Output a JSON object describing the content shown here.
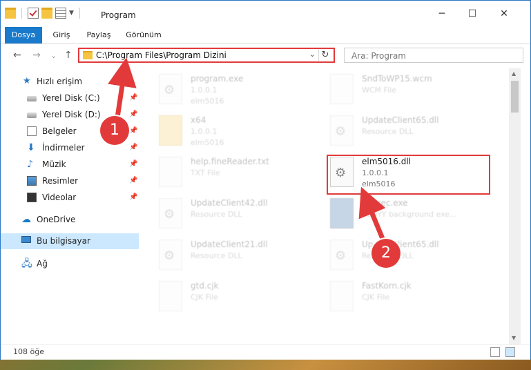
{
  "window": {
    "title": "Program",
    "controls": {
      "minimize": "─",
      "maximize": "☐",
      "close": "✕"
    }
  },
  "ribbon": {
    "tabs": [
      "Dosya",
      "Giriş",
      "Paylaş",
      "Görünüm"
    ],
    "help": "?"
  },
  "navigation": {
    "back": "←",
    "forward": "→",
    "recent": "⌄",
    "up": "↑",
    "address": "C:\\Program Files\\Program Dizini",
    "search_placeholder": "Ara: Program"
  },
  "sidebar": {
    "items": [
      {
        "label": "Hızlı erişim",
        "icon": "star-icon"
      },
      {
        "label": "Yerel Disk (C:)",
        "icon": "disk-icon"
      },
      {
        "label": "Yerel Disk (D:)",
        "icon": "disk-icon"
      },
      {
        "label": "Belgeler",
        "icon": "documents-icon"
      },
      {
        "label": "İndirmeler",
        "icon": "download-icon"
      },
      {
        "label": "Müzik",
        "icon": "music-icon"
      },
      {
        "label": "Resimler",
        "icon": "pictures-icon"
      },
      {
        "label": "Videolar",
        "icon": "videos-icon"
      },
      {
        "label": "OneDrive",
        "icon": "cloud-icon"
      },
      {
        "label": "Bu bilgisayar",
        "icon": "computer-icon"
      },
      {
        "label": "Ağ",
        "icon": "network-icon"
      }
    ]
  },
  "files": [
    {
      "name": "program.exe",
      "l2": "1.0.0.1",
      "l3": "elm5016"
    },
    {
      "name": "SndToWP15.wcm",
      "l2": "WCM File",
      "l3": ""
    },
    {
      "name": "x64",
      "l2": "1.0.0.1",
      "l3": "elm5016"
    },
    {
      "name": "UpdateClient65.dll",
      "l2": "Resource DLL",
      "l3": ""
    },
    {
      "name": "help.fineReader.txt",
      "l2": "TXT File",
      "l3": ""
    },
    {
      "name": "elm5016.dll",
      "l2": "1.0.0.1",
      "l3": "elm5016"
    },
    {
      "name": "UpdateClient42.dll",
      "l2": "Resource DLL",
      "l3": ""
    },
    {
      "name": "BrExec.exe",
      "l2": "ABBYY background exe...",
      "l3": ""
    },
    {
      "name": "UpdateClient21.dll",
      "l2": "Resource DLL",
      "l3": ""
    },
    {
      "name": "UpdateClient65.dll",
      "l2": "Resource DLL",
      "l3": ""
    },
    {
      "name": "gtd.cjk",
      "l2": "CJK File",
      "l3": ""
    },
    {
      "name": "FastKorn.cjk",
      "l2": "CJK File",
      "l3": ""
    }
  ],
  "status": {
    "count": "108 öğe"
  },
  "annotations": {
    "step1": "1",
    "step2": "2",
    "highlight_color": "#e23a3a"
  },
  "colors": {
    "accent": "#1979ca",
    "selection": "#cce8ff"
  }
}
